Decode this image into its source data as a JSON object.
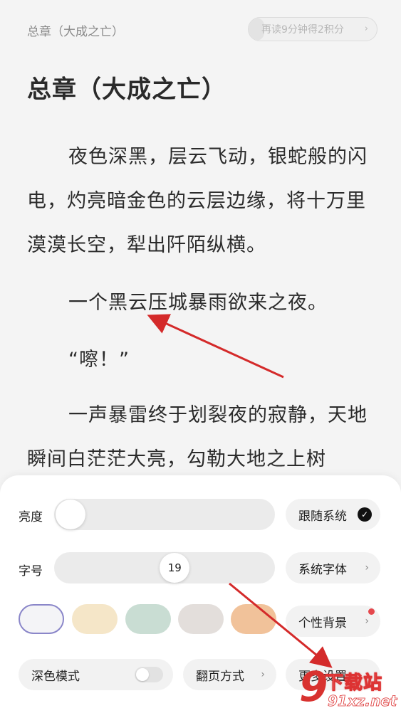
{
  "header": {
    "chapter_crumb": "总章（大成之亡）",
    "reward_text": "再读9分钟得2积分",
    "reward_chevron": "›",
    "reward_progress_fraction": 0.12
  },
  "article": {
    "title": "总章（大成之亡）",
    "paragraphs": [
      "夜色深黑，层云飞动，银蛇般的闪电，灼亮暗金色的云层边缘，将十万里漠漠长空，犁出阡陌纵横。",
      "一个黑云压城暴雨欲来之夜。",
      "“嚓！”",
      "一声暴雷终于划裂夜的寂静，天地瞬间白茫茫大亮，勾勒大地之上树"
    ]
  },
  "settings": {
    "brightness": {
      "label": "亮度",
      "level_fraction": 0.0,
      "follow_system_label": "跟随系统",
      "follow_system_checked": true
    },
    "font_size": {
      "label": "字号",
      "value": "19",
      "level_fraction": 0.55,
      "font_label": "系统字体",
      "chevron": "›"
    },
    "background": {
      "swatches": [
        "#f4f4f7",
        "#f5e6c8",
        "#c9ddd3",
        "#e3dedb",
        "#f1c29a"
      ],
      "selected_index": 0,
      "custom_label": "个性背景",
      "chevron": "›",
      "has_new_badge": true
    },
    "bottom_row": {
      "dark_mode_label": "深色模式",
      "dark_mode_on": false,
      "page_turn_label": "翻页方式",
      "page_turn_chevron": "›",
      "more_settings_label": "更多设置"
    }
  },
  "watermark": {
    "top_text": "下载站",
    "bottom_text": "91xz.net",
    "glyph": "9"
  },
  "colors": {
    "page_bg": "#f4f4f4",
    "annotation_arrow": "#d42a2a",
    "badge_red": "#e5484d"
  }
}
